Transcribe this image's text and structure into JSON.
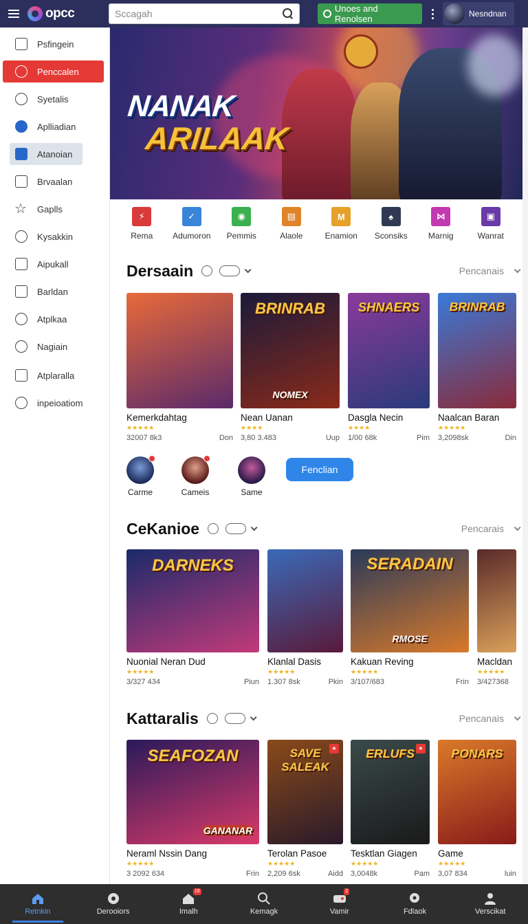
{
  "header": {
    "logo_text": "opcc",
    "search_placeholder": "Sccagah",
    "promo_label": "Unoes and Renolsen",
    "user_name": "Nesndnan"
  },
  "sidebar": {
    "items": [
      {
        "label": "Psfingein",
        "icon": "square-dot-icon"
      },
      {
        "label": "Penccalen",
        "icon": "search-icon",
        "active": true
      },
      {
        "label": "Syetalis",
        "icon": "circle-icon"
      },
      {
        "label": "Aplliadian",
        "icon": "app-blue-icon"
      },
      {
        "label": "Atanoian",
        "icon": "app-icon",
        "selected": true
      },
      {
        "label": "Brvaalan",
        "icon": "calendar-icon"
      },
      {
        "label": "Gaplls",
        "icon": "star-icon"
      },
      {
        "label": "Kysakkin",
        "icon": "download-icon"
      },
      {
        "label": "Aipukall",
        "icon": "window-icon"
      },
      {
        "label": "Barldan",
        "icon": "grid-icon"
      },
      {
        "label": "Atplkaa",
        "icon": "magnifier-icon"
      },
      {
        "label": "Nagiain",
        "icon": "clock-icon"
      },
      {
        "label": "Atplaralla",
        "icon": "chart-icon"
      },
      {
        "label": "inpeioatiom",
        "icon": "info-search-icon"
      }
    ]
  },
  "hero": {
    "title_line1": "NANAK",
    "title_line2": "ARILAAK"
  },
  "categories": [
    {
      "label": "Rema",
      "color": "#d93a3a",
      "glyph": "⚡"
    },
    {
      "label": "Adumoron",
      "color": "#3a84d9",
      "glyph": "✓"
    },
    {
      "label": "Pemmis",
      "color": "#3ab04e",
      "glyph": "◉"
    },
    {
      "label": "Alaole",
      "color": "#e0842a",
      "glyph": "▤"
    },
    {
      "label": "Enamion",
      "color": "#e6a12a",
      "glyph": "M"
    },
    {
      "label": "Sconsiks",
      "color": "#2f3a52",
      "glyph": "♠"
    },
    {
      "label": "Marnig",
      "color": "#c23ab0",
      "glyph": "⋈"
    },
    {
      "label": "Wanrat",
      "color": "#6a3aa8",
      "glyph": "▣"
    }
  ],
  "sections": [
    {
      "title": "Dersaain",
      "filter": "Pencanais",
      "cards": [
        {
          "title": "Kemerkdahtag",
          "meta": "32007 8k3",
          "tag": "Don",
          "stars": "★★★★★",
          "logo": ""
        },
        {
          "title": "Nean Uanan",
          "meta": "3,80 3.483",
          "tag": "Uup",
          "stars": "★★★★",
          "logo": "BRINRAB"
        },
        {
          "title": "Dasgla Necin",
          "meta": "1/00 68k",
          "tag": "Pim",
          "stars": "★★★★",
          "logo": "SHNAERS"
        },
        {
          "title": "Naalcan Baran",
          "meta": "3,2098sk",
          "tag": "Din",
          "stars": "★★★★★",
          "logo": "BRINRAB"
        }
      ],
      "card_sublogo": "NOMEX"
    },
    {
      "title": "CeKanioe",
      "filter": "Pencarais",
      "cards": [
        {
          "title": "Nuonial Neran Dud",
          "meta": "3/327 434",
          "tag": "Piun",
          "stars": "★★★★★",
          "logo": "DARNEKS"
        },
        {
          "title": "Klanlal Dasis",
          "meta": "1.307 8sk",
          "tag": "Pkin",
          "stars": "★★★★★",
          "logo": ""
        },
        {
          "title": "Kakuan Reving",
          "meta": "3/107/683",
          "tag": "Frin",
          "stars": "★★★★★",
          "logo": "SERADAIN"
        },
        {
          "title": "Macldan",
          "meta": "3/427368",
          "tag": "",
          "stars": "★★★★★",
          "logo": ""
        }
      ],
      "card_sublogo": "RMOSE"
    },
    {
      "title": "Kattaralis",
      "filter": "Pencanais",
      "cards": [
        {
          "title": "Neraml Nssin Dang",
          "meta": "3 2092 634",
          "tag": "Frin",
          "stars": "★★★★★",
          "logo": "SEAFOZAN"
        },
        {
          "title": "Terolan Pasoe",
          "meta": "2,209 6sk",
          "tag": "Aidd",
          "stars": "★★★★★",
          "logo": "SAVE SALEAK"
        },
        {
          "title": "Tesktlan Giagen",
          "meta": "3,0048k",
          "tag": "Pam",
          "stars": "★★★★★",
          "logo": "ERLUFS"
        },
        {
          "title": "Game",
          "meta": "3,07 834",
          "tag": "luin",
          "stars": "★★★★★",
          "logo": "PONARS"
        }
      ],
      "card_sublogo": "GANANAR"
    }
  ],
  "friends": [
    {
      "label": "Carme"
    },
    {
      "label": "Cameis"
    },
    {
      "label": "Same"
    }
  ],
  "more_button": "Fenclian",
  "bottom_nav": [
    {
      "label": "Retnkin",
      "icon": "home-icon",
      "active": true
    },
    {
      "label": "Derooiors",
      "icon": "game-disc-icon"
    },
    {
      "label": "Imalh",
      "icon": "house-icon",
      "badge": "18"
    },
    {
      "label": "Kemagk",
      "icon": "search-icon"
    },
    {
      "label": "Vamir",
      "icon": "controller-icon",
      "badge": "2"
    },
    {
      "label": "Fdlaok",
      "icon": "location-icon"
    },
    {
      "label": "Verscikat",
      "icon": "profile-icon"
    }
  ]
}
